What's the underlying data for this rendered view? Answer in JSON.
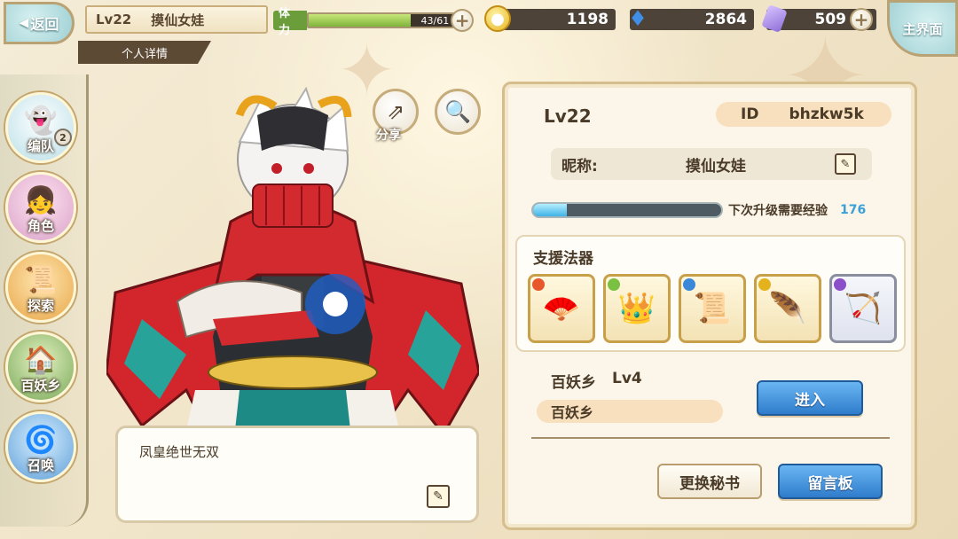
{
  "header": {
    "back_label": "返回",
    "player_level": "Lv22",
    "player_name": "摸仙女娃",
    "detail_tab": "个人详情",
    "stamina_label": "体力",
    "stamina_value": "43/61",
    "stamina_fraction": 0.7,
    "gold": "1198",
    "soul": "2864",
    "crystal": "509",
    "main_menu_label": "主界面"
  },
  "sidebar": {
    "items": [
      {
        "label": "编队",
        "badge": "2"
      },
      {
        "label": "角色"
      },
      {
        "label": "探索"
      },
      {
        "label": "百妖乡"
      },
      {
        "label": "召唤"
      }
    ]
  },
  "character": {
    "share_label": "分享",
    "speech": "凤皇绝世无双"
  },
  "profile": {
    "level": "Lv22",
    "id_label": "ID",
    "id_value": "bhzkw5k",
    "nickname_label": "昵称:",
    "nickname_value": "摸仙女娃",
    "exp_label": "下次升级需要经验",
    "exp_value": "176",
    "exp_fraction": 0.18,
    "support_title": "支援法器",
    "village_title": "百妖乡",
    "village_level": "Lv4",
    "village_name": "百妖乡",
    "enter_label": "进入",
    "change_secretary_label": "更换秘书",
    "message_board_label": "留言板"
  },
  "colors": {
    "accent_blue": "#2f7ccc",
    "panel_bg": "#fbf6e9",
    "exp_blue": "#3aa0d8",
    "stamina_green": "#7fb43a"
  }
}
